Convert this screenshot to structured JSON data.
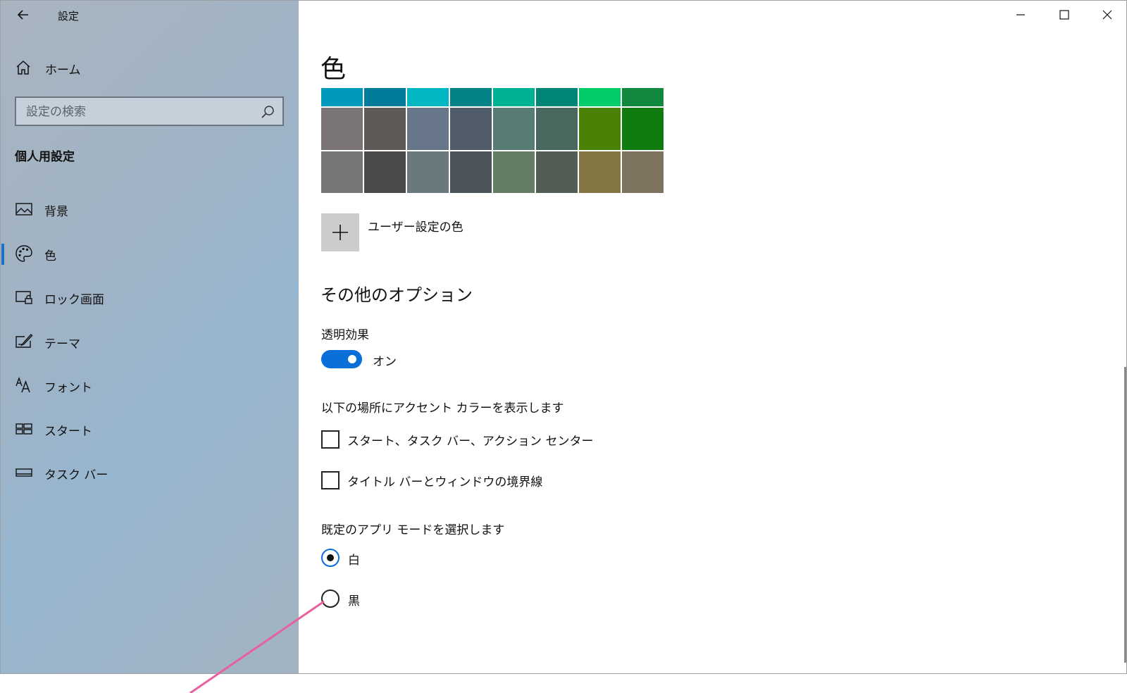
{
  "window": {
    "title": "設定",
    "controls": [
      "minimize-icon",
      "maximize-icon",
      "close-icon"
    ]
  },
  "sidebar": {
    "home_label": "ホーム",
    "search_placeholder": "設定の検索",
    "section_title": "個人用設定",
    "items": [
      {
        "label": "背景",
        "icon": "image-icon",
        "selected": false
      },
      {
        "label": "色",
        "icon": "palette-icon",
        "selected": true
      },
      {
        "label": "ロック画面",
        "icon": "lock-screen-icon",
        "selected": false
      },
      {
        "label": "テーマ",
        "icon": "theme-brush-icon",
        "selected": false
      },
      {
        "label": "フォント",
        "icon": "font-icon",
        "selected": false
      },
      {
        "label": "スタート",
        "icon": "start-tiles-icon",
        "selected": false
      },
      {
        "label": "タスク バー",
        "icon": "taskbar-icon",
        "selected": false
      }
    ]
  },
  "main": {
    "title": "色",
    "swatch_rows": [
      [
        "#0099BC",
        "#007B9A",
        "#00B7C3",
        "#038387",
        "#00B294",
        "#018574",
        "#00CC6A",
        "#10893E"
      ],
      [
        "#7A7574",
        "#5D5A58",
        "#68768A",
        "#515C6B",
        "#567C73",
        "#486860",
        "#498205",
        "#107C10"
      ],
      [
        "#767676",
        "#4C4A48",
        "#69797E",
        "#4A5459",
        "#647C64",
        "#525E54",
        "#847545",
        "#7E735F"
      ]
    ],
    "custom_color_label": "ユーザー設定の色",
    "options_heading": "その他のオプション",
    "transparency": {
      "label": "透明効果",
      "state_text": "オン",
      "on": true
    },
    "accent_surfaces": {
      "label": "以下の場所にアクセント カラーを表示します",
      "options": [
        {
          "label": "スタート、タスク バー、アクション センター",
          "checked": false
        },
        {
          "label": "タイトル バーとウィンドウの境界線",
          "checked": false
        }
      ]
    },
    "app_mode": {
      "label": "既定のアプリ モードを選択します",
      "options": [
        {
          "label": "白",
          "selected": true
        },
        {
          "label": "黒",
          "selected": false
        }
      ]
    }
  },
  "colors": {
    "accent": "#0A6FD8",
    "annotation_line": "#E8609E"
  }
}
